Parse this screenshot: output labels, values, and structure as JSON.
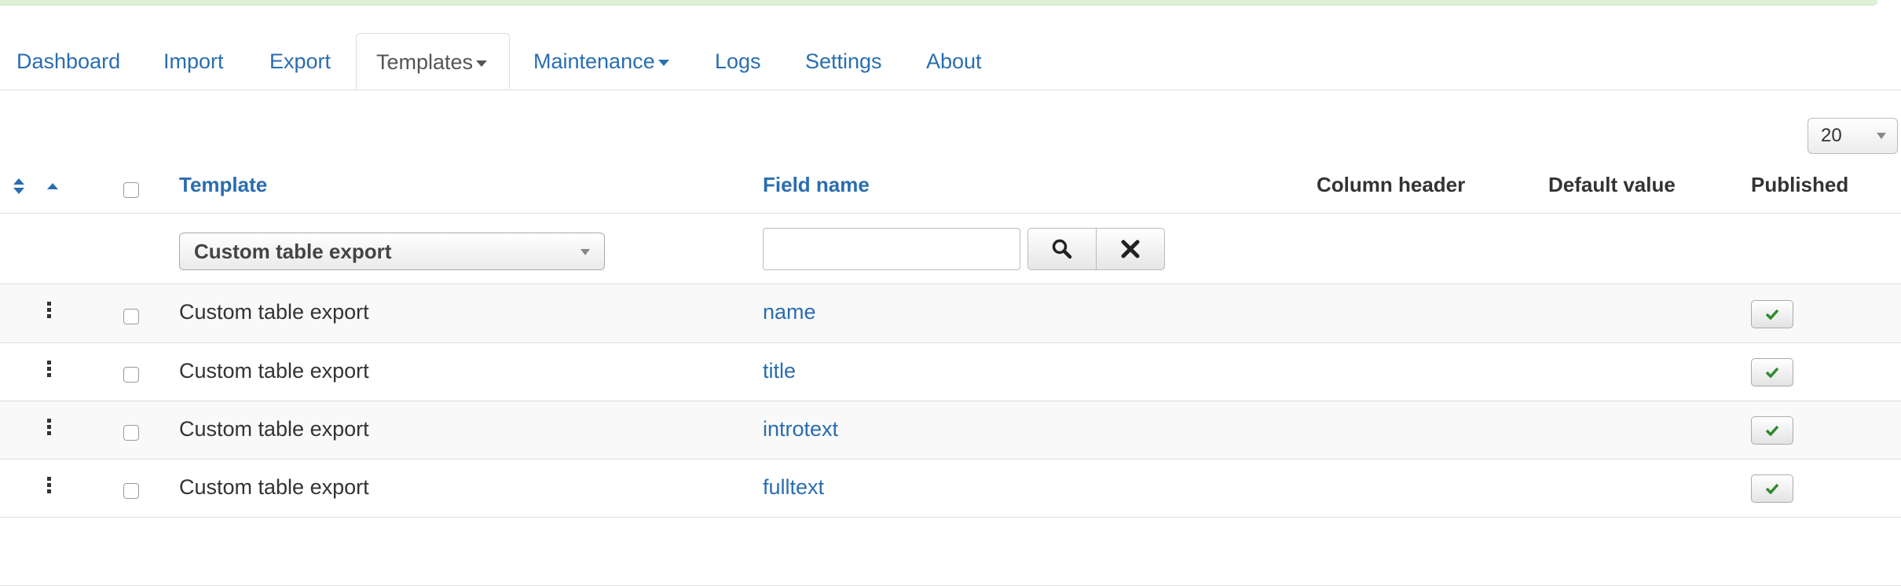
{
  "nav": {
    "tabs": [
      {
        "label": "Dashboard"
      },
      {
        "label": "Import"
      },
      {
        "label": "Export"
      },
      {
        "label": "Templates",
        "dropdown": true,
        "active": true
      },
      {
        "label": "Maintenance",
        "dropdown": true
      },
      {
        "label": "Logs"
      },
      {
        "label": "Settings"
      },
      {
        "label": "About"
      }
    ]
  },
  "list": {
    "limit": "20",
    "columns": {
      "template": "Template",
      "field_name": "Field name",
      "column_header": "Column header",
      "default_value": "Default value",
      "published": "Published"
    },
    "filters": {
      "template_selected": "Custom table export",
      "search_value": "",
      "search_placeholder": ""
    },
    "rows": [
      {
        "template": "Custom table export",
        "field": "name",
        "published": true
      },
      {
        "template": "Custom table export",
        "field": "title",
        "published": true
      },
      {
        "template": "Custom table export",
        "field": "introtext",
        "published": true
      },
      {
        "template": "Custom table export",
        "field": "fulltext",
        "published": true
      }
    ]
  },
  "icons": {
    "sort": "sort-both-icon",
    "sort_asc": "sort-asc-icon",
    "drag": "drag-handle-icon",
    "search": "search-icon",
    "clear": "close-icon",
    "published": "check-icon"
  },
  "colors": {
    "link": "#2a6db0",
    "success": "#2f8a2f",
    "topbar": "#dff0d8"
  }
}
